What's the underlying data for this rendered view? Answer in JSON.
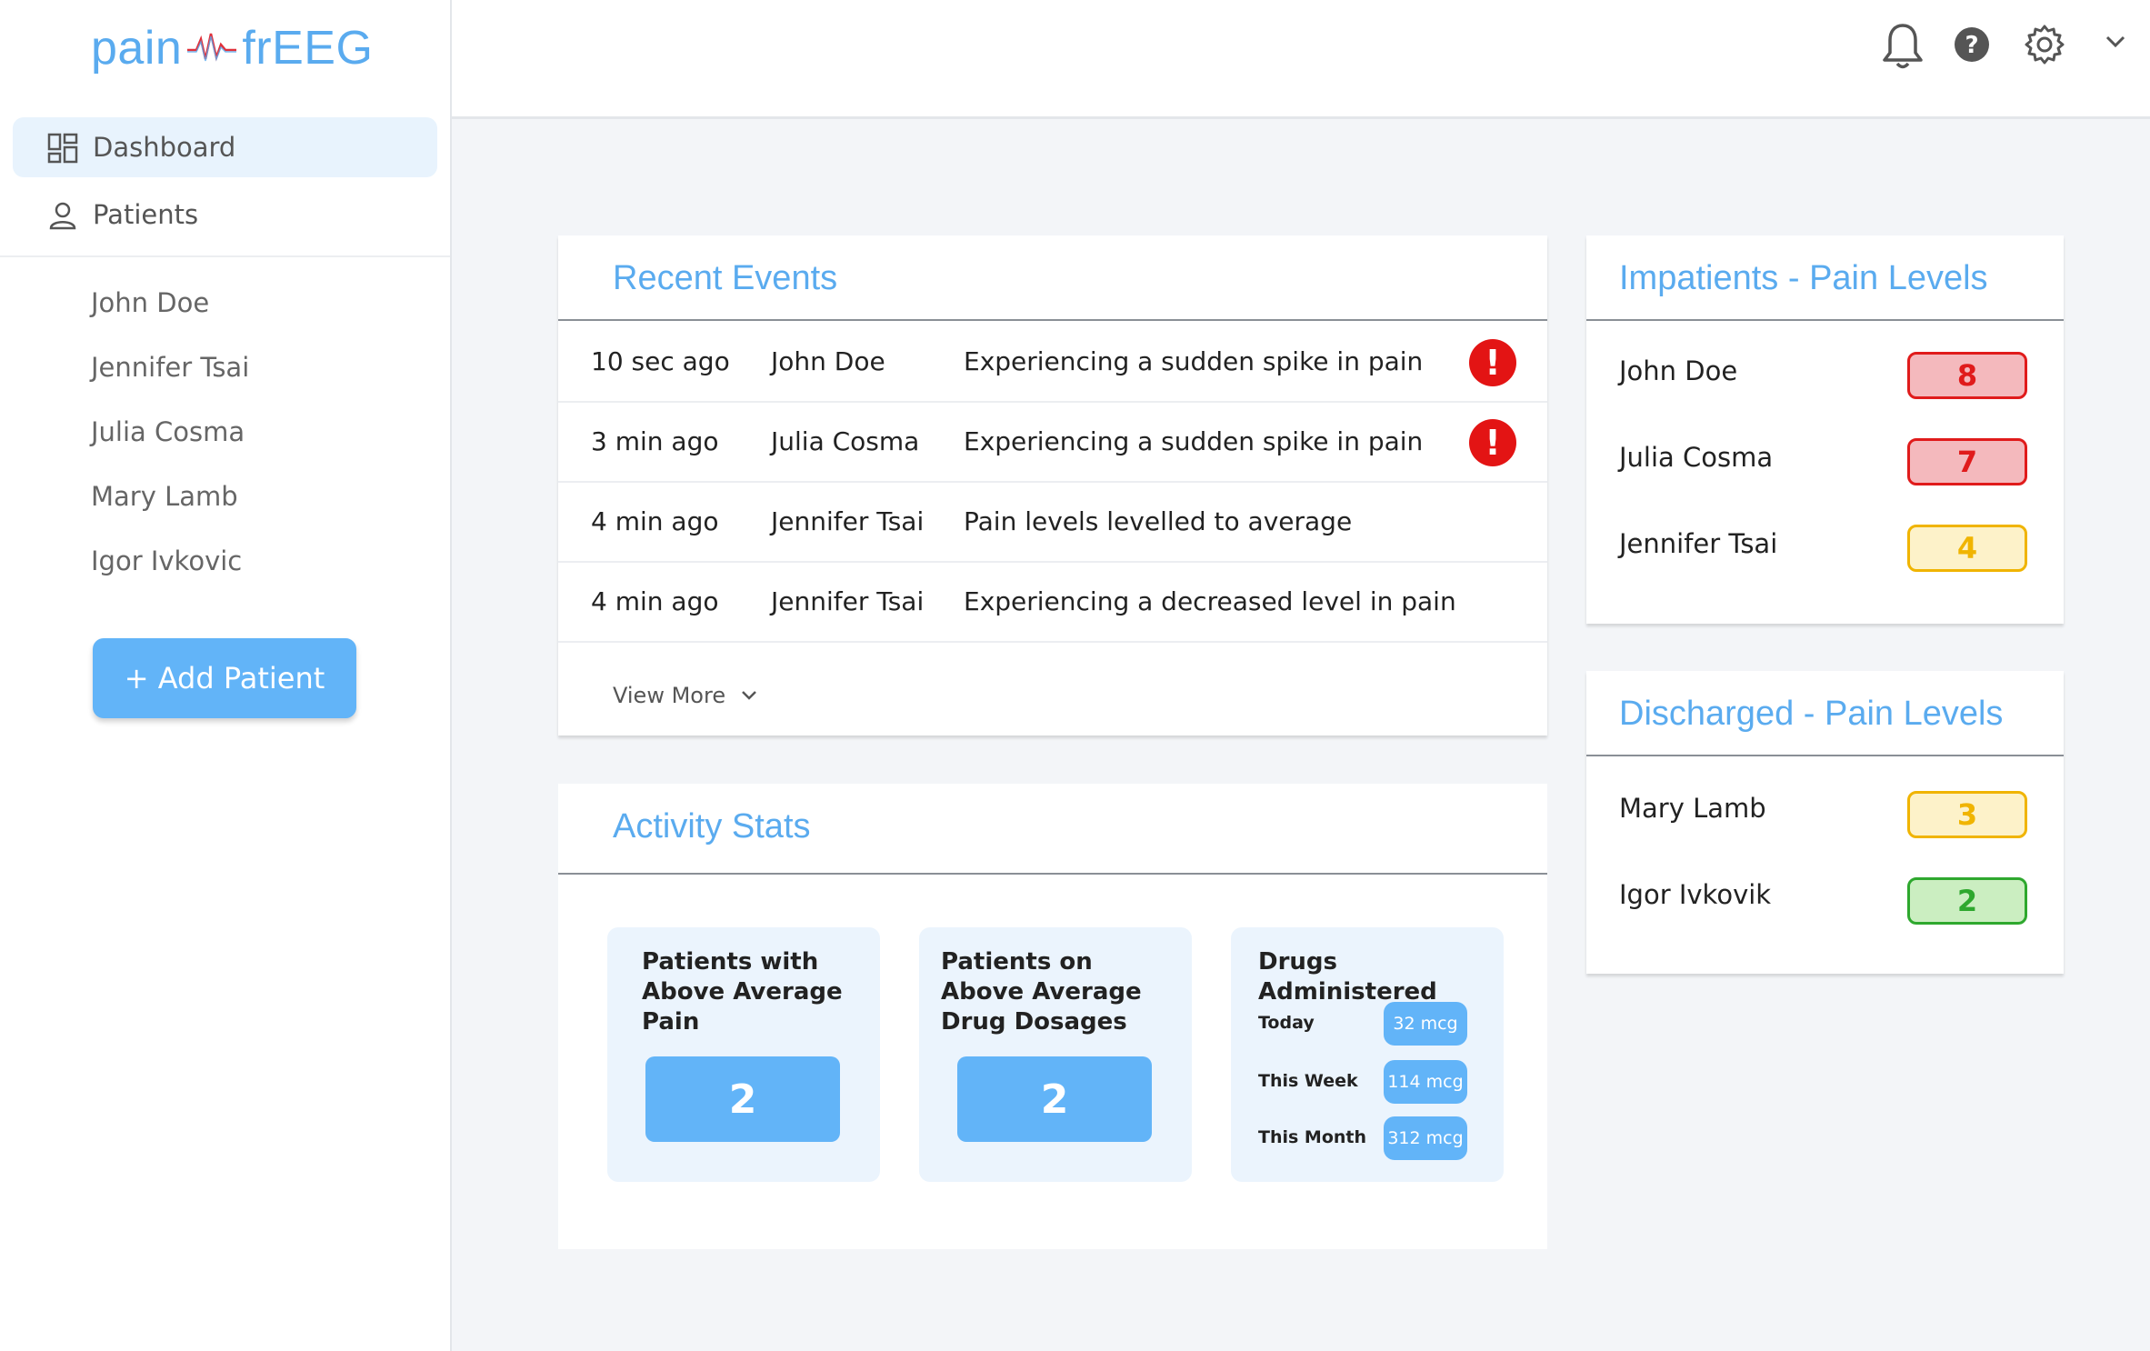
{
  "app": {
    "logo_left": "pain",
    "logo_right": "frEEG"
  },
  "sidebar": {
    "nav": [
      {
        "label": "Dashboard",
        "icon": "dashboard-icon",
        "active": true
      },
      {
        "label": "Patients",
        "icon": "person-icon",
        "active": false
      }
    ],
    "patients": [
      "John Doe",
      "Jennifer Tsai",
      "Julia Cosma",
      "Mary Lamb",
      "Igor Ivkovic"
    ],
    "add_button": "+ Add Patient"
  },
  "topbar": {
    "icons": [
      "bell-icon",
      "help-icon",
      "gear-icon",
      "chevron-down-icon"
    ]
  },
  "recent_events": {
    "title": "Recent Events",
    "rows": [
      {
        "time": "10 sec ago",
        "name": "John Doe",
        "event": "Experiencing a sudden spike in pain",
        "alert": true
      },
      {
        "time": "3 min ago",
        "name": "Julia Cosma",
        "event": "Experiencing a sudden spike in pain",
        "alert": true
      },
      {
        "time": "4 min ago",
        "name": "Jennifer Tsai",
        "event": "Pain levels levelled to average",
        "alert": false
      },
      {
        "time": "4 min ago",
        "name": "Jennifer Tsai",
        "event": "Experiencing a decreased level in pain",
        "alert": false
      }
    ],
    "view_more": "View More"
  },
  "activity_stats": {
    "title": "Activity Stats",
    "above_avg_pain": {
      "title": "Patients with Above Average Pain",
      "value": "2"
    },
    "above_avg_drug": {
      "title": "Patients on Above Average Drug Dosages",
      "value": "2"
    },
    "drugs": {
      "title": "Drugs Administered",
      "rows": [
        {
          "label": "Today",
          "value": "32 mcg"
        },
        {
          "label": "This Week",
          "value": "114 mcg"
        },
        {
          "label": "This Month",
          "value": "312 mcg"
        }
      ]
    }
  },
  "inpatients": {
    "title": "Impatients - Pain Levels",
    "rows": [
      {
        "name": "John Doe",
        "level": "8",
        "color": "#e01b1b",
        "bg": "#f4b9bd"
      },
      {
        "name": "Julia Cosma",
        "level": "7",
        "color": "#e01b1b",
        "bg": "#f4b9bd"
      },
      {
        "name": "Jennifer Tsai",
        "level": "4",
        "color": "#f0b400",
        "bg": "#fdf2c9"
      }
    ]
  },
  "discharged": {
    "title": "Discharged - Pain Levels",
    "rows": [
      {
        "name": "Mary Lamb",
        "level": "3",
        "color": "#f0b400",
        "bg": "#fdf2c9"
      },
      {
        "name": "Igor Ivkovik",
        "level": "2",
        "color": "#2ea82e",
        "bg": "#cbeec1"
      }
    ]
  },
  "colors": {
    "accent": "#5aabef",
    "button": "#62b4f8",
    "alert": "#e31414"
  }
}
